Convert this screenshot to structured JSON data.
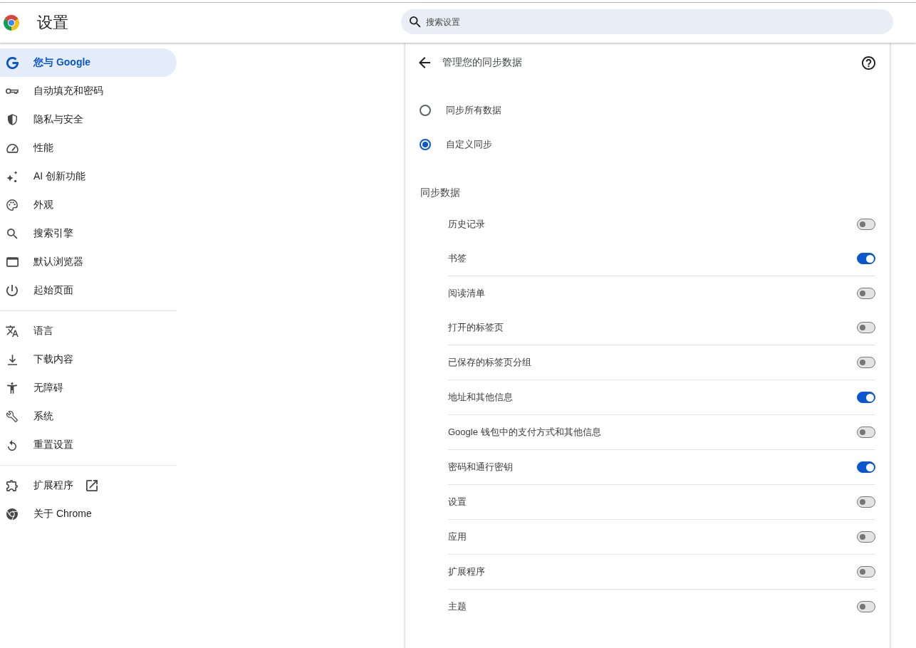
{
  "header": {
    "title": "设置",
    "search": {
      "placeholder": "搜索设置"
    }
  },
  "sidebar": {
    "groups": [
      {
        "items": [
          {
            "label": "您与 Google",
            "selected": true
          },
          {
            "label": "自动填充和密码",
            "selected": false
          },
          {
            "label": "隐私与安全",
            "selected": false
          },
          {
            "label": "性能",
            "selected": false
          },
          {
            "label": "AI 创新功能",
            "selected": false
          },
          {
            "label": "外观",
            "selected": false
          },
          {
            "label": "搜索引擎",
            "selected": false
          },
          {
            "label": "默认浏览器",
            "selected": false
          },
          {
            "label": "起始页面",
            "selected": false
          }
        ]
      },
      {
        "items": [
          {
            "label": "语言",
            "selected": false
          },
          {
            "label": "下载内容",
            "selected": false
          },
          {
            "label": "无障碍",
            "selected": false
          },
          {
            "label": "系统",
            "selected": false
          },
          {
            "label": "重置设置",
            "selected": false
          }
        ]
      },
      {
        "items": [
          {
            "label": "扩展程序",
            "selected": false
          },
          {
            "label": "关于 Chrome",
            "selected": false
          }
        ]
      }
    ]
  },
  "panel": {
    "title": "管理您的同步数据",
    "sync_options": [
      {
        "label": "同步所有数据",
        "selected": false
      },
      {
        "label": "自定义同步",
        "selected": true
      }
    ],
    "section_title": "同步数据",
    "sync_items": [
      {
        "label": "历史记录",
        "on": false
      },
      {
        "label": "书签",
        "on": true
      },
      {
        "label": "阅读清单",
        "on": false
      },
      {
        "label": "打开的标签页",
        "on": false
      },
      {
        "label": "已保存的标签页分组",
        "on": false
      },
      {
        "label": "地址和其他信息",
        "on": true
      },
      {
        "label": "Google 钱包中的支付方式和其他信息",
        "on": false
      },
      {
        "label": "密码和通行密钥",
        "on": true
      },
      {
        "label": "设置",
        "on": false
      },
      {
        "label": "应用",
        "on": false
      },
      {
        "label": "扩展程序",
        "on": false
      },
      {
        "label": "主题",
        "on": false
      }
    ]
  }
}
